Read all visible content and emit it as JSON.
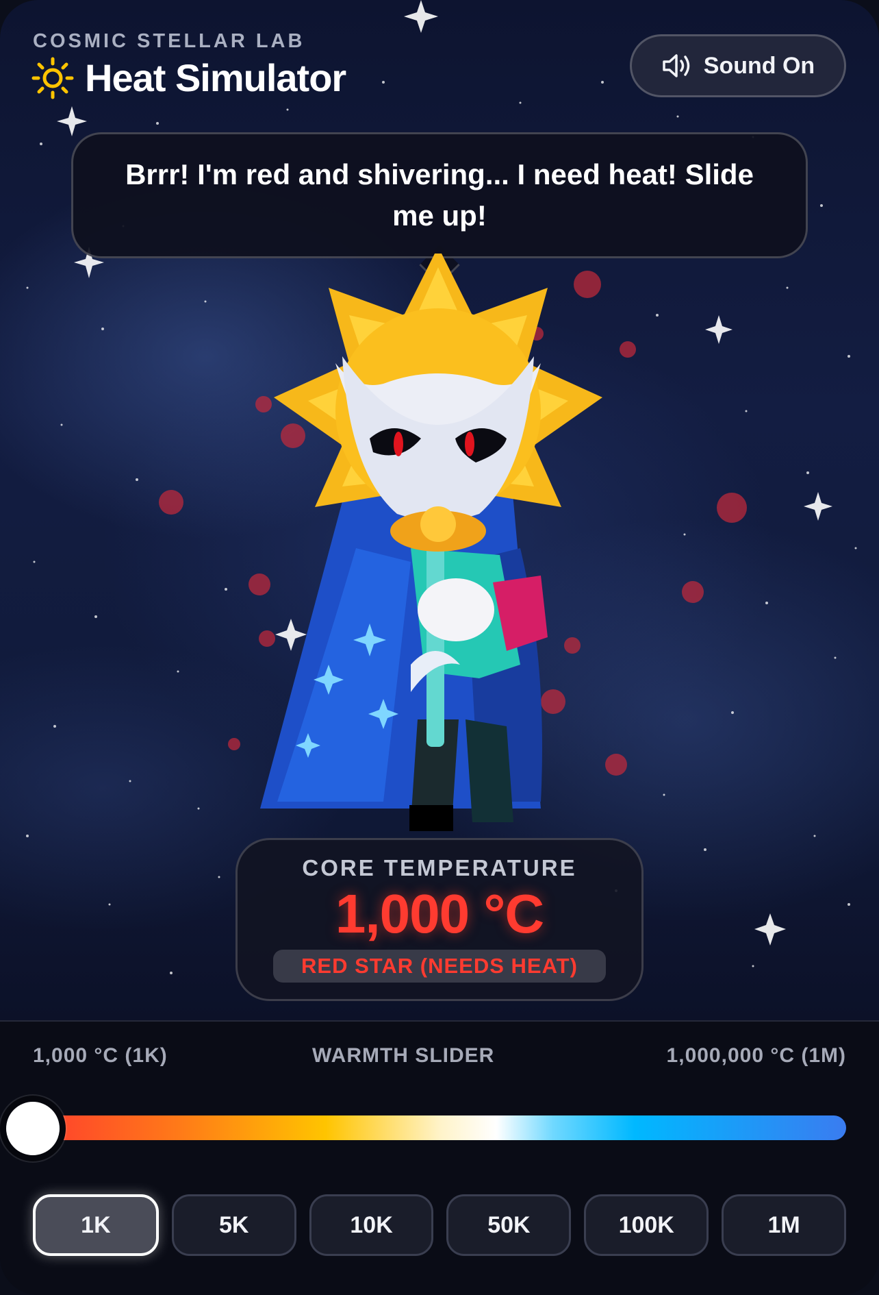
{
  "header": {
    "brand": "COSMIC STELLAR LAB",
    "title": "Heat Simulator",
    "sound_label": "Sound On",
    "icons": [
      "sun-icon",
      "speaker-icon"
    ]
  },
  "speech": {
    "text": "Brrr! I'm red and shivering... I need heat! Slide me up!"
  },
  "temperature": {
    "label": "CORE TEMPERATURE",
    "value": "1,000 °C",
    "status": "RED STAR (NEEDS HEAT)",
    "status_color": "#ff3b30"
  },
  "slider": {
    "min_label": "1,000 °C (1K)",
    "title": "WARMTH SLIDER",
    "max_label": "1,000,000 °C (1M)",
    "position": 0
  },
  "presets": [
    {
      "label": "1K",
      "active": true
    },
    {
      "label": "5K",
      "active": false
    },
    {
      "label": "10K",
      "active": false
    },
    {
      "label": "50K",
      "active": false
    },
    {
      "label": "100K",
      "active": false
    },
    {
      "label": "1M",
      "active": false
    }
  ],
  "colors": {
    "background": "#0a0d18",
    "accent_red": "#ff3b30",
    "sun_yellow": "#ffc400"
  }
}
